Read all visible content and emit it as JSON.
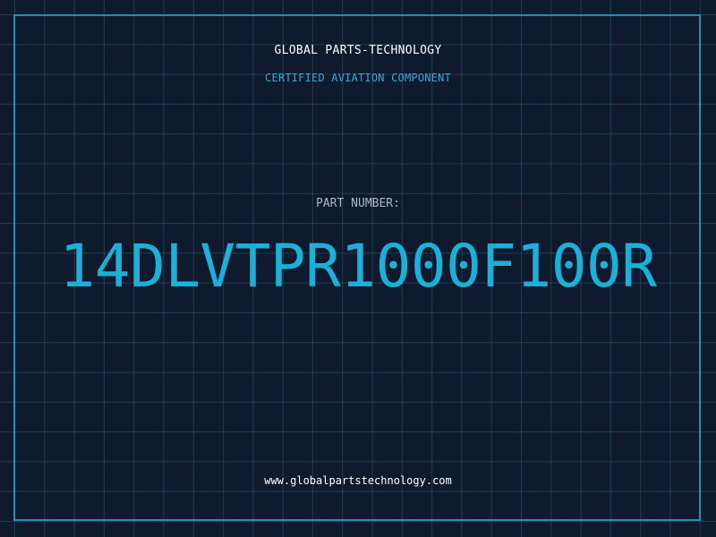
{
  "brand": {
    "company": "GLOBAL PARTS-TECHNOLOGY",
    "tagline": "CERTIFIED AVIATION COMPONENT"
  },
  "part": {
    "label": "PART NUMBER:",
    "number": "14DLVTPR1000F100R"
  },
  "footer": {
    "website": "www.globalpartstechnology.com"
  },
  "colors": {
    "background": "#101a2e",
    "grid": "#3c7896",
    "frame": "#1f8fb3",
    "accent": "#1ab0d8",
    "tagline": "#3aa6d8"
  }
}
